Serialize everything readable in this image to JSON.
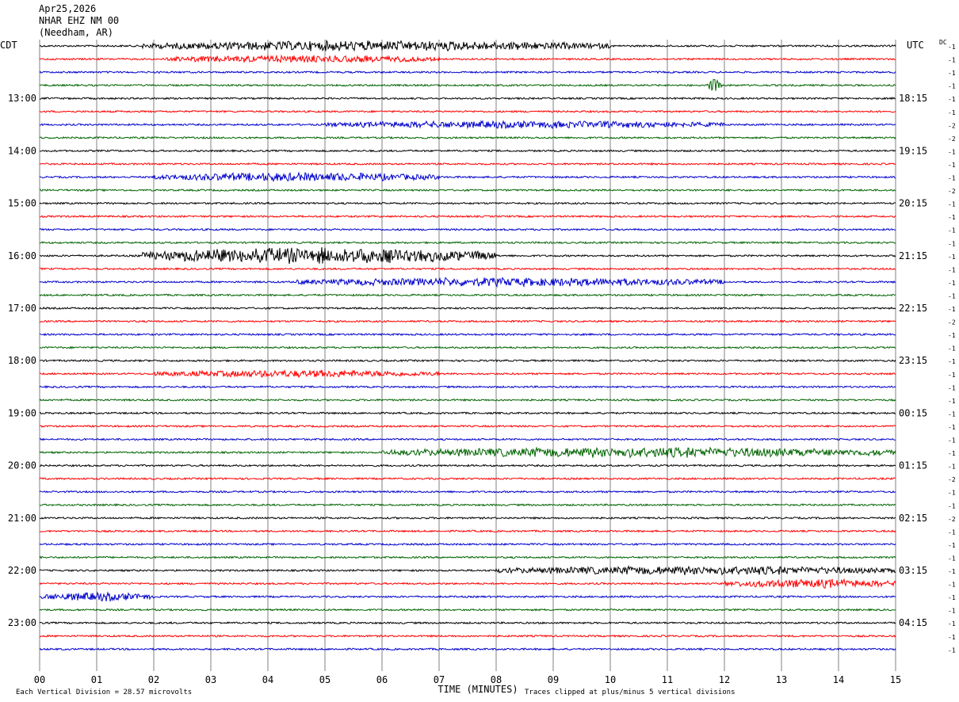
{
  "header": {
    "date": "Apr25,2026",
    "station": "NHAR EHZ NM 00",
    "location": "(Needham, AR)"
  },
  "left_tz": "CDT",
  "right_tz": "UTC",
  "dc_label": "DC",
  "footer": {
    "vertical_division": "Each Vertical Division =  28.57 microvolts",
    "xlabel": "TIME (MINUTES)",
    "clip_note": "Traces clipped at plus/minus 5 vertical divisions"
  },
  "chart_data": {
    "type": "line",
    "title": "",
    "xlabel": "TIME (MINUTES)",
    "x_ticks": [
      "00",
      "01",
      "02",
      "03",
      "04",
      "05",
      "06",
      "07",
      "08",
      "09",
      "10",
      "11",
      "12",
      "13",
      "14",
      "15"
    ],
    "xlim": [
      0,
      15
    ],
    "grid": true,
    "trace_minutes": 15,
    "traces_per_hour": 4,
    "color_cycle": [
      "#000000",
      "#ff0000",
      "#0000cc",
      "#006400"
    ],
    "left_hour_labels": [
      "13:00",
      "14:00",
      "15:00",
      "16:00",
      "17:00",
      "18:00",
      "19:00",
      "20:00",
      "21:00",
      "22:00",
      "23:00"
    ],
    "right_hour_labels": [
      "18:15",
      "19:15",
      "20:15",
      "21:15",
      "22:15",
      "23:15",
      "00:15",
      "01:15",
      "02:15",
      "03:15",
      "04:15"
    ],
    "dc_offsets": [
      "-1",
      "-1",
      "-1",
      "-1",
      "-1",
      "-1",
      "-2",
      "-2",
      "-1",
      "-1",
      "-1",
      "-2",
      "-1",
      "-1",
      "-1",
      "-1",
      "-1",
      "-1",
      "-1",
      "-1",
      "-1",
      "-2",
      "-1",
      "-1",
      "-1",
      "-1",
      "-1",
      "-1",
      "-1",
      "-1",
      "-1",
      "-1",
      "-1",
      "-2",
      "-1",
      "-1",
      "-2",
      "-1",
      "-1",
      "-1",
      "-1",
      "-1",
      "-1",
      "-1",
      "-1",
      "-1",
      "-1"
    ],
    "events": [
      {
        "trace": 0,
        "start_min": 1.8,
        "end_min": 10.0,
        "amplitude": 6
      },
      {
        "trace": 1,
        "start_min": 2.2,
        "end_min": 7.0,
        "amplitude": 4
      },
      {
        "trace": 3,
        "start_min": 11.7,
        "end_min": 11.95,
        "amplitude": 8
      },
      {
        "trace": 6,
        "start_min": 5.0,
        "end_min": 12.0,
        "amplitude": 4
      },
      {
        "trace": 10,
        "start_min": 2.0,
        "end_min": 7.0,
        "amplitude": 5
      },
      {
        "trace": 16,
        "start_min": 1.8,
        "end_min": 8.0,
        "amplitude": 10
      },
      {
        "trace": 18,
        "start_min": 4.5,
        "end_min": 12.0,
        "amplitude": 5
      },
      {
        "trace": 25,
        "start_min": 2.0,
        "end_min": 7.0,
        "amplitude": 4
      },
      {
        "trace": 31,
        "start_min": 6.0,
        "end_min": 15.0,
        "amplitude": 6
      },
      {
        "trace": 40,
        "start_min": 8.0,
        "end_min": 15.0,
        "amplitude": 5
      },
      {
        "trace": 41,
        "start_min": 12.0,
        "end_min": 15.0,
        "amplitude": 5
      },
      {
        "trace": 42,
        "start_min": 0.0,
        "end_min": 2.0,
        "amplitude": 5
      }
    ]
  }
}
